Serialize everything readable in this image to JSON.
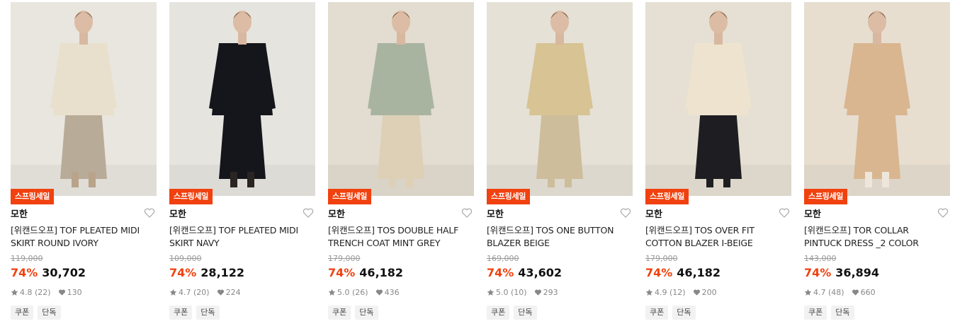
{
  "colors": {
    "accent": "#f0410f",
    "muted": "#999999",
    "text": "#111111"
  },
  "products": [
    {
      "badge": "스프링세일",
      "brand": "모한",
      "name_line1": "[위캔드오프] TOF PLEATED MIDI",
      "name_line2": "SKIRT ROUND IVORY",
      "original_price": "119,000",
      "discount": "74%",
      "price": "30,702",
      "rating": "4.8",
      "reviews": "(22)",
      "likes": "130",
      "tags": [
        "쿠폰",
        "단독"
      ],
      "image": {
        "bg": "#e9e6df",
        "outfit": "#e8e0cc",
        "skirt": "#b8ab98",
        "legs": "#b9a48a"
      }
    },
    {
      "badge": "스프링세일",
      "brand": "모한",
      "name_line1": "[위캔드오프] TOF PLEATED MIDI",
      "name_line2": "SKIRT NAVY",
      "original_price": "109,000",
      "discount": "74%",
      "price": "28,122",
      "rating": "4.7",
      "reviews": "(20)",
      "likes": "224",
      "tags": [
        "쿠폰",
        "단독"
      ],
      "image": {
        "bg": "#e6e4df",
        "outfit": "#15161c",
        "skirt": "#15161c",
        "legs": "#2a2422"
      }
    },
    {
      "badge": "스프링세일",
      "brand": "모한",
      "name_line1": "[위캔드오프] TOS DOUBLE HALF",
      "name_line2": "TRENCH COAT MINT GREY",
      "original_price": "179,000",
      "discount": "74%",
      "price": "46,182",
      "rating": "5.0",
      "reviews": "(26)",
      "likes": "436",
      "tags": [
        "쿠폰",
        "단독"
      ],
      "image": {
        "bg": "#e2ddd0",
        "outfit": "#a9b4a0",
        "skirt": "#ddd0b7",
        "legs": "#ddd0b7"
      }
    },
    {
      "badge": "스프링세일",
      "brand": "모한",
      "name_line1": "[위캔드오프] TOS ONE BUTTON",
      "name_line2": "BLAZER BEIGE",
      "original_price": "169,000",
      "discount": "74%",
      "price": "43,602",
      "rating": "5.0",
      "reviews": "(10)",
      "likes": "293",
      "tags": [
        "쿠폰",
        "단독"
      ],
      "image": {
        "bg": "#e5e1d6",
        "outfit": "#d7c393",
        "skirt": "#cdbd9b",
        "legs": "#cdbd9b"
      }
    },
    {
      "badge": "스프링세일",
      "brand": "모한",
      "name_line1": "[위캔드오프] TOS OVER FIT",
      "name_line2": "COTTON BLAZER I-BEIGE",
      "original_price": "179,000",
      "discount": "74%",
      "price": "46,182",
      "rating": "4.9",
      "reviews": "(12)",
      "likes": "200",
      "tags": [
        "쿠폰",
        "단독"
      ],
      "image": {
        "bg": "#e5e0d3",
        "outfit": "#ede3cf",
        "skirt": "#1e1e22",
        "legs": "#1e1e22"
      }
    },
    {
      "badge": "스프링세일",
      "brand": "모한",
      "name_line1": "[위캔드오프] TOR COLLAR",
      "name_line2": "PINTUCK DRESS _2 COLOR",
      "original_price": "143,000",
      "discount": "74%",
      "price": "36,894",
      "rating": "4.7",
      "reviews": "(48)",
      "likes": "660",
      "tags": [
        "쿠폰",
        "단독"
      ],
      "image": {
        "bg": "#e7ded0",
        "outfit": "#d9b690",
        "skirt": "#d9b690",
        "legs": "#eee6da"
      }
    }
  ]
}
